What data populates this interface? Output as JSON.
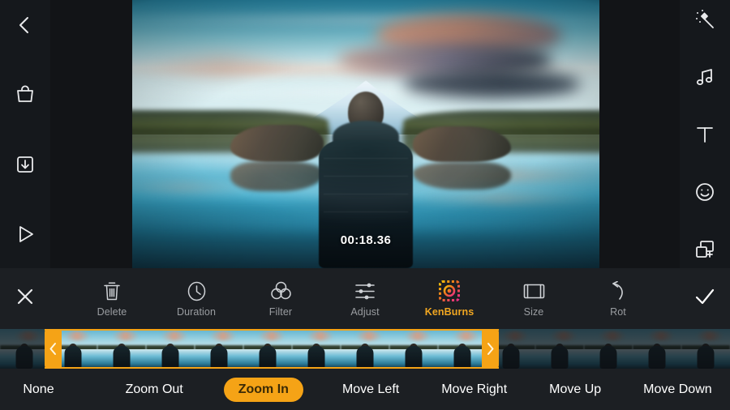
{
  "app": {
    "accent_color": "#f5a316",
    "toolbar_bg": "#1c1f23",
    "panel_bg": "#15181c"
  },
  "preview": {
    "timestamp": "00:18.36",
    "scene_description": "Person in dark puffer jacket standing before mirrored mountain lake at dusk"
  },
  "rail_left": {
    "items": [
      {
        "name": "back-icon",
        "label": "Back"
      },
      {
        "name": "shop-bag-icon",
        "label": "Store"
      },
      {
        "name": "download-icon",
        "label": "Export"
      },
      {
        "name": "play-icon",
        "label": "Play"
      }
    ]
  },
  "rail_right": {
    "items": [
      {
        "name": "magic-wand-icon",
        "label": "Effects"
      },
      {
        "name": "music-note-icon",
        "label": "Music"
      },
      {
        "name": "text-icon",
        "label": "Text"
      },
      {
        "name": "sticker-smiley-icon",
        "label": "Sticker"
      },
      {
        "name": "pip-overlay-icon",
        "label": "Overlay"
      }
    ]
  },
  "toolbar": {
    "close_label": "Close",
    "confirm_label": "Confirm",
    "items": [
      {
        "label": "Delete",
        "icon": "trash-icon",
        "active": false
      },
      {
        "label": "Duration",
        "icon": "clock-icon",
        "active": false
      },
      {
        "label": "Filter",
        "icon": "filter-icon",
        "active": false
      },
      {
        "label": "Adjust",
        "icon": "sliders-icon",
        "active": false
      },
      {
        "label": "KenBurns",
        "icon": "kenburns-icon",
        "active": true
      },
      {
        "label": "Size",
        "icon": "size-icon",
        "active": false
      },
      {
        "label": "Rot",
        "icon": "rotate-icon",
        "active": false
      }
    ]
  },
  "timeline": {
    "left_handle_icon": "chevron-left-icon",
    "right_handle_icon": "chevron-right-icon",
    "frames": 15,
    "selection_start_frame": 1,
    "selection_end_frame": 10
  },
  "options": {
    "selected": "Zoom In",
    "items": [
      {
        "label": "None",
        "selected": false
      },
      {
        "label": "Zoom Out",
        "selected": false
      },
      {
        "label": "Zoom In",
        "selected": true
      },
      {
        "label": "Move Left",
        "selected": false
      },
      {
        "label": "Move Right",
        "selected": false
      },
      {
        "label": "Move Up",
        "selected": false
      },
      {
        "label": "Move Down",
        "selected": false
      }
    ]
  }
}
